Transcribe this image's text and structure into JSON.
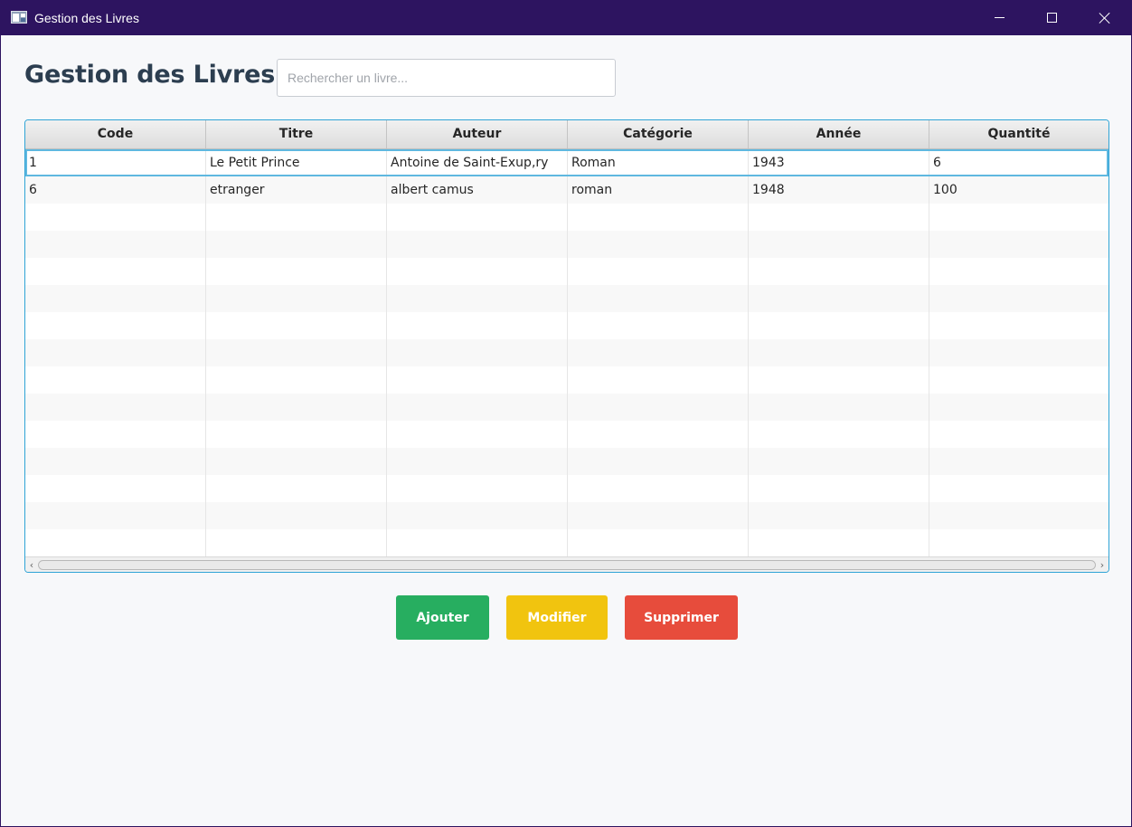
{
  "window": {
    "title": "Gestion des Livres"
  },
  "header": {
    "title": "Gestion des Livres",
    "search_placeholder": "Rechercher un livre...",
    "search_value": ""
  },
  "table": {
    "columns": [
      "Code",
      "Titre",
      "Auteur",
      "Catégorie",
      "Année",
      "Quantité"
    ],
    "rows": [
      [
        "1",
        "Le Petit Prince",
        "Antoine de Saint-Exup,ry",
        "Roman",
        "1943",
        "6"
      ],
      [
        "6",
        "etranger",
        "albert camus",
        "roman",
        "1948",
        "100"
      ]
    ],
    "selected_row": 0
  },
  "actions": {
    "add_label": "Ajouter",
    "edit_label": "Modifier",
    "delete_label": "Supprimer"
  },
  "colors": {
    "titlebar": "#2d1460",
    "add": "#27ae60",
    "edit": "#f1c40f",
    "delete": "#e74c3c",
    "table_focus": "#2fa4d6",
    "heading": "#2c3e50"
  }
}
